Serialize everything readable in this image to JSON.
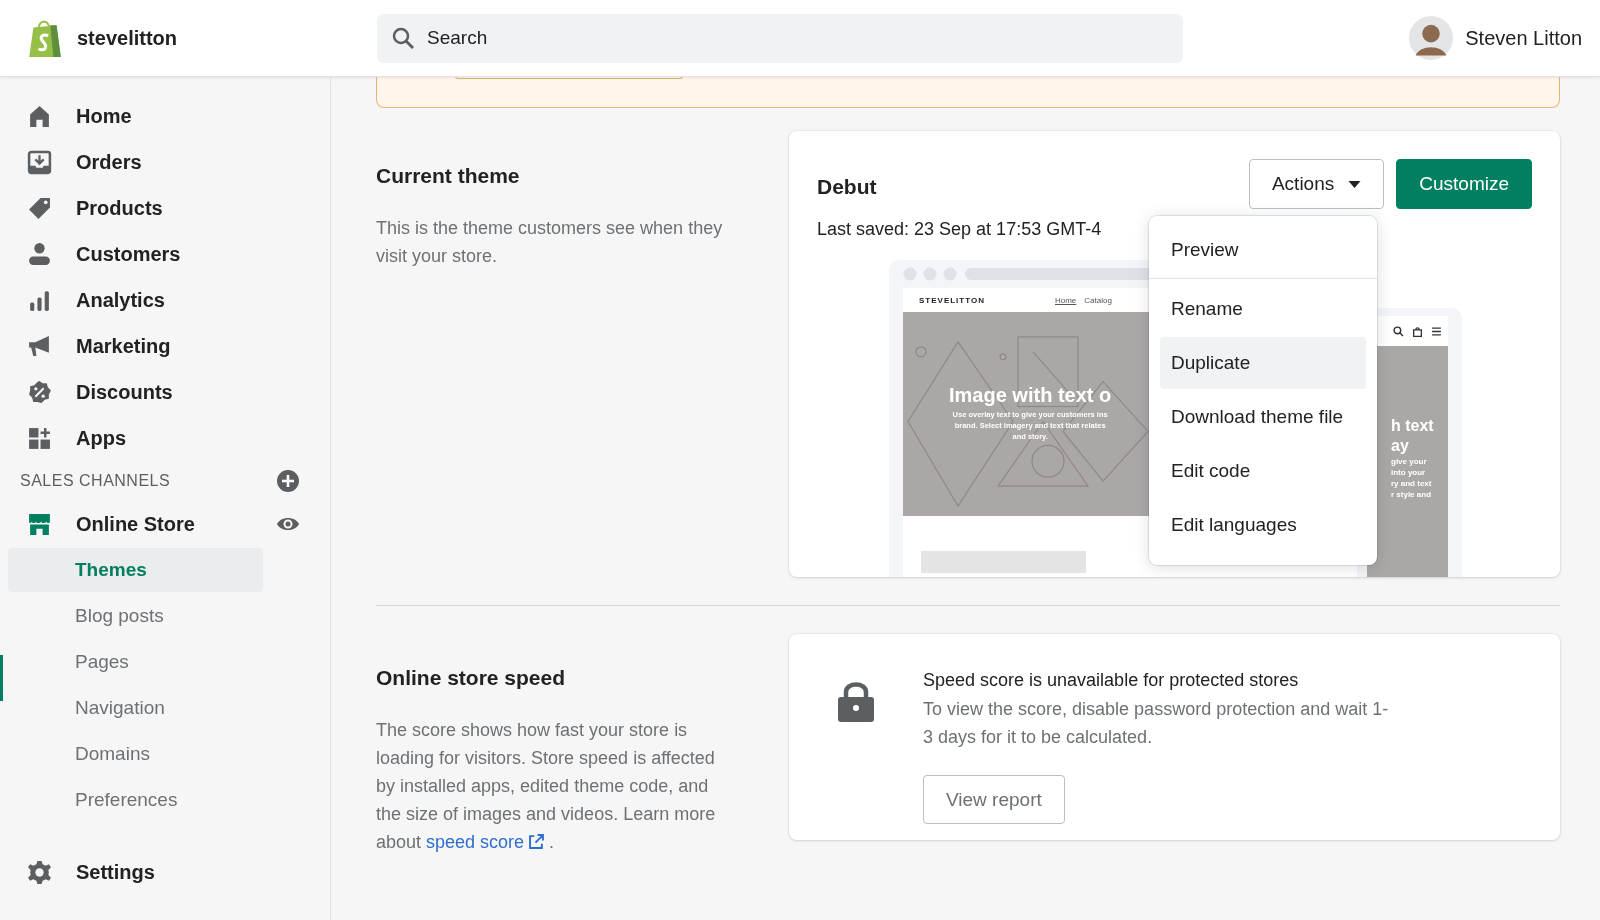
{
  "store": {
    "name": "stevelitton"
  },
  "search": {
    "placeholder": "Search"
  },
  "user": {
    "name": "Steven Litton"
  },
  "nav": [
    {
      "label": "Home"
    },
    {
      "label": "Orders"
    },
    {
      "label": "Products"
    },
    {
      "label": "Customers"
    },
    {
      "label": "Analytics"
    },
    {
      "label": "Marketing"
    },
    {
      "label": "Discounts"
    },
    {
      "label": "Apps"
    }
  ],
  "sales_channels": {
    "title": "SALES CHANNELS",
    "channel": "Online Store",
    "items": [
      {
        "label": "Themes",
        "selected": true
      },
      {
        "label": "Blog posts",
        "selected": false
      },
      {
        "label": "Pages",
        "selected": false
      },
      {
        "label": "Navigation",
        "selected": false
      },
      {
        "label": "Domains",
        "selected": false
      },
      {
        "label": "Preferences",
        "selected": false
      }
    ]
  },
  "settings": {
    "label": "Settings"
  },
  "current_theme": {
    "title": "Current theme",
    "description": "This is the theme customers see when they visit your store.",
    "theme_name": "Debut",
    "last_saved": "Last saved: 23 Sep at 17:53 GMT-4",
    "actions_button": "Actions",
    "customize_button": "Customize",
    "actions_menu": [
      {
        "label": "Preview",
        "highlighted": false
      },
      {
        "label": "Rename",
        "highlighted": false
      },
      {
        "label": "Duplicate",
        "highlighted": true
      },
      {
        "label": "Download theme file",
        "highlighted": false
      },
      {
        "label": "Edit code",
        "highlighted": false
      },
      {
        "label": "Edit languages",
        "highlighted": false
      }
    ],
    "preview": {
      "site_name": "STEVELITTON",
      "links": [
        "Home",
        "Catalog"
      ],
      "hero_title": "Image with text o",
      "hero_lines": [
        "Use overlay text to give your customers ins",
        "brand. Select imagery and text that relates",
        "and story."
      ],
      "mobile_title_lines": [
        "h text",
        "ay"
      ],
      "mobile_lines": [
        "give your",
        "into your",
        "ry and text",
        "r style and"
      ]
    }
  },
  "speed": {
    "title": "Online store speed",
    "description": "The score shows how fast your store is loading for visitors. Store speed is affected by installed apps, edited theme code, and the size of images and videos. Learn more about",
    "link": "speed score",
    "after_link": ".",
    "card_title": "Speed score is unavailable for protected stores",
    "card_text": "To view the score, disable password protection and wait 1-3 days for it to be calculated.",
    "button": "View report"
  }
}
